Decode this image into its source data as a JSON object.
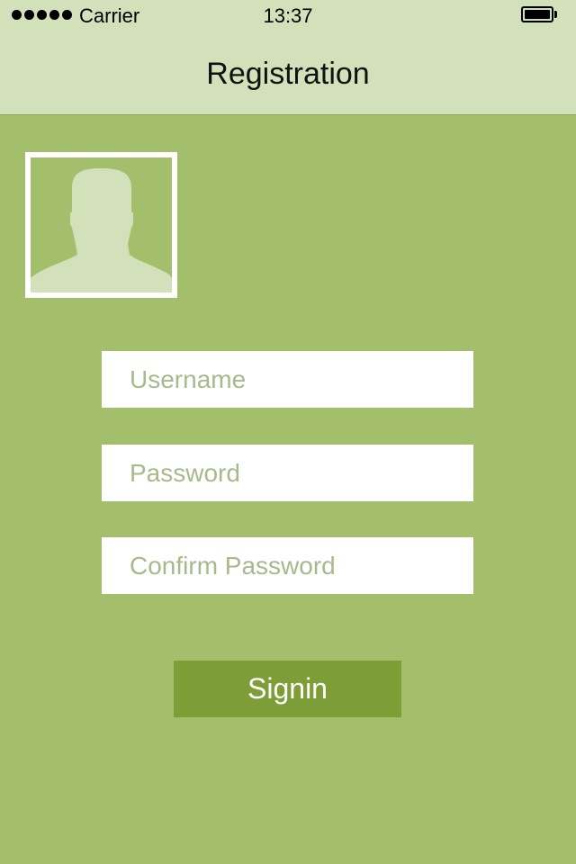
{
  "status_bar": {
    "signal_dots": 5,
    "carrier": "Carrier",
    "time": "13:37",
    "battery_level": 1.0
  },
  "nav": {
    "title": "Registration"
  },
  "avatar": {
    "icon": "person-silhouette-icon"
  },
  "form": {
    "username_placeholder": "Username",
    "username_value": "",
    "password_placeholder": "Password",
    "password_value": "",
    "confirm_placeholder": "Confirm Password",
    "confirm_value": "",
    "signin_label": "Signin"
  },
  "colors": {
    "background": "#a4bf6c",
    "header": "#d3e1bb",
    "button": "#7d9d37",
    "field": "#ffffff",
    "placeholder": "#a8b98c"
  }
}
